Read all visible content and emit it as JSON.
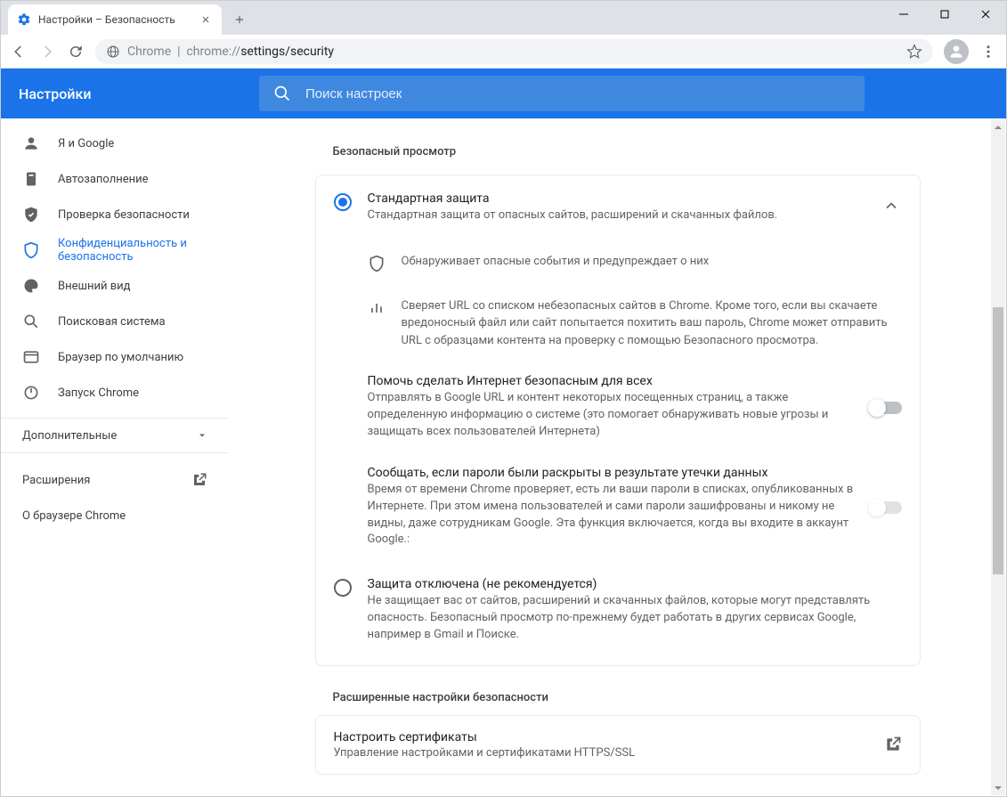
{
  "window": {
    "tab_title": "Настройки – Безопасность"
  },
  "toolbar": {
    "url_prefix": "Chrome",
    "url_gray": "chrome://",
    "url_dark": "settings/security"
  },
  "header": {
    "title": "Настройки",
    "search_placeholder": "Поиск настроек"
  },
  "sidebar": {
    "items": [
      {
        "label": "Я и Google",
        "icon": "person-icon"
      },
      {
        "label": "Автозаполнение",
        "icon": "autofill-icon"
      },
      {
        "label": "Проверка безопасности",
        "icon": "shield-check-icon"
      },
      {
        "label": "Конфиденциальность и безопасность",
        "icon": "shield-icon"
      },
      {
        "label": "Внешний вид",
        "icon": "palette-icon"
      },
      {
        "label": "Поисковая система",
        "icon": "search-icon"
      },
      {
        "label": "Браузер по умолчанию",
        "icon": "browser-icon"
      },
      {
        "label": "Запуск Chrome",
        "icon": "power-icon"
      }
    ],
    "advanced": "Дополнительные",
    "extensions": "Расширения",
    "about": "О браузере Chrome"
  },
  "main": {
    "section_title": "Безопасный просмотр",
    "standard": {
      "title": "Стандартная защита",
      "subtitle": "Стандартная защита от опасных сайтов, расширений и скачанных файлов.",
      "detail1": "Обнаруживает опасные события и предупреждает о них",
      "detail2": "Сверяет URL со списком небезопасных сайтов в Chrome. Кроме того, если вы скачаете вредоносный файл или сайт попытается похитить ваш пароль, Chrome может отправить URL с образцами контента на проверку с помощью Безопасного просмотра."
    },
    "help_safe": {
      "title": "Помочь сделать Интернет безопасным для всех",
      "subtitle": "Отправлять в Google URL и контент некоторых посещенных страниц, а также определенную информацию о системе (это помогает обнаруживать новые угрозы и защищать всех пользователей Интернета)"
    },
    "leak_warn": {
      "title": "Сообщать, если пароли были раскрыты в результате утечки данных",
      "subtitle": "Время от времени Chrome проверяет, есть ли ваши пароли в списках, опубликованных в Интернете. При этом имена пользователей и сами пароли зашифрованы и никому не видны, даже сотрудникам Google. Эта функция включается, когда вы входите в аккаунт Google.:"
    },
    "disabled": {
      "title": "Защита отключена (не рекомендуется)",
      "subtitle": "Не защищает вас от сайтов, расширений и скачанных файлов, которые могут представлять опасность. Безопасный просмотр по-прежнему будет работать в других сервисах Google, например в Gmail и Поиске."
    },
    "advanced_title": "Расширенные настройки безопасности",
    "certs": {
      "title": "Настроить сертификаты",
      "subtitle": "Управление настройками и сертификатами HTTPS/SSL"
    }
  }
}
